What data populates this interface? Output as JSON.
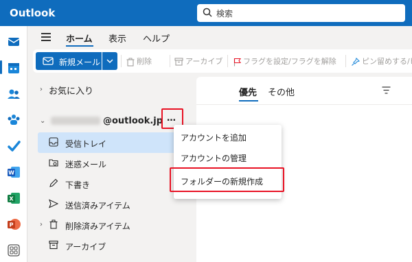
{
  "header": {
    "app_title": "Outlook",
    "search_placeholder": "検索"
  },
  "rail": {
    "icons": [
      "mail-icon",
      "calendar-icon",
      "people-icon",
      "groups-icon",
      "todo-icon",
      "word-icon",
      "excel-icon",
      "powerpoint-icon",
      "apps-icon"
    ]
  },
  "menubar": {
    "tabs": [
      "ホーム",
      "表示",
      "ヘルプ"
    ],
    "active_tab": "ホーム"
  },
  "ribbon": {
    "new_mail": "新規メール",
    "delete": "削除",
    "archive": "アーカイブ",
    "flag": "フラグを設定/フラグを解除",
    "pin": "ピン留めする/ピ"
  },
  "folders": {
    "favorites": "お気に入り",
    "account": "@outlook.jp",
    "more": "…",
    "items": [
      "受信トレイ",
      "迷惑メール",
      "下書き",
      "送信済みアイテム",
      "削除済みアイテム",
      "アーカイブ"
    ],
    "selected": "受信トレイ"
  },
  "message_list": {
    "tab_focused": "優先",
    "tab_other": "その他"
  },
  "context_menu": {
    "items": [
      "アカウントを追加",
      "アカウントの管理",
      "フォルダーの新規作成"
    ],
    "highlighted": "フォルダーの新規作成"
  },
  "colors": {
    "brand": "#0f6cbd",
    "highlight_box": "#e81123",
    "selected_bg": "#cfe4fa"
  }
}
